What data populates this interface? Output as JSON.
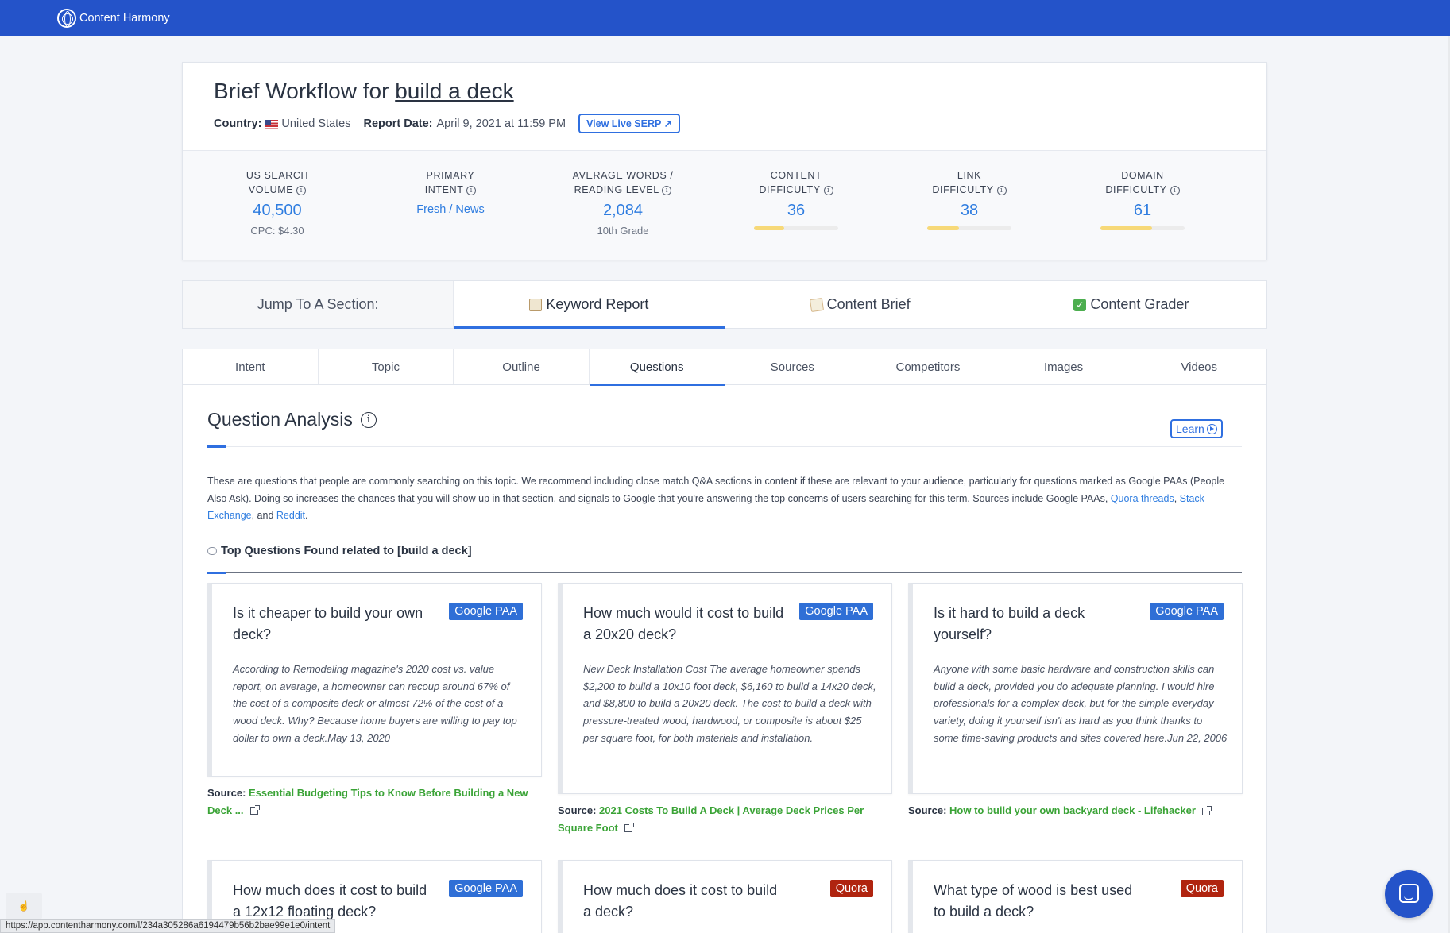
{
  "app": {
    "brand": "Content Harmony"
  },
  "header": {
    "title_prefix": "Brief Workflow for ",
    "keyword": "build a deck",
    "country_label": "Country:",
    "country": "United States",
    "report_date_label": "Report Date:",
    "report_date": "April 9, 2021 at 11:59 PM",
    "serp_button": "View Live SERP"
  },
  "metrics": [
    {
      "label1": "US SEARCH",
      "label2": "VOLUME",
      "value": "40,500",
      "sub": "CPC: $4.30"
    },
    {
      "label1": "PRIMARY",
      "label2": "INTENT",
      "value": "Fresh / News"
    },
    {
      "label1": "AVERAGE WORDS /",
      "label2": "READING LEVEL",
      "value": "2,084",
      "sub": "10th Grade"
    },
    {
      "label1": "CONTENT",
      "label2": "DIFFICULTY",
      "value": "36",
      "level": 0.36
    },
    {
      "label1": "LINK",
      "label2": "DIFFICULTY",
      "value": "38",
      "level": 0.38
    },
    {
      "label1": "DOMAIN",
      "label2": "DIFFICULTY",
      "value": "61",
      "level": 0.61
    }
  ],
  "jump": {
    "label": "Jump To A Section:",
    "items": [
      "Keyword Report",
      "Content Brief",
      "Content Grader"
    ],
    "active": "Keyword Report"
  },
  "tabs": {
    "items": [
      "Intent",
      "Topic",
      "Outline",
      "Questions",
      "Sources",
      "Competitors",
      "Images",
      "Videos"
    ],
    "active": "Questions"
  },
  "question_analysis": {
    "title": "Question Analysis",
    "learn_button": "Learn",
    "description_pre": "These are questions that people are commonly searching on this topic. We recommend including close match Q&A sections in content if these are relevant to your audience, particularly for questions marked as Google PAAs (People Also Ask). Doing so increases the chances that you will show up in that section, and signals to Google that you're answering the top concerns of users searching for this term. Sources include Google PAAs, ",
    "link_quora": "Quora threads",
    "sep1": ", ",
    "link_stack": "Stack Exchange",
    "sep2": ", and ",
    "link_reddit": "Reddit",
    "end": ".",
    "top_questions_label": "Top Questions Found related to [build a deck]"
  },
  "source_label": "Source:",
  "questions": [
    {
      "question": "Is it cheaper to build your own deck?",
      "badge": "Google PAA",
      "answer": "According to Remodeling magazine's 2020 cost vs. value report, on average, a homeowner can recoup around 67% of the cost of a composite deck or almost 72% of the cost of a wood deck. Why? Because home buyers are willing to pay top dollar to own a deck.May 13, 2020",
      "source": "Essential Budgeting Tips to Know Before Building a New Deck ..."
    },
    {
      "question": "How much would it cost to build a 20x20 deck?",
      "badge": "Google PAA",
      "answer": "New Deck Installation Cost The average homeowner spends $2,200 to build a 10x10 foot deck, $6,160 to build a 14x20 deck, and $8,800 to build a 20x20 deck. The cost to build a deck with pressure-treated wood, hardwood, or composite is about $25 per square foot, for both materials and installation.",
      "source": "2021 Costs To Build A Deck | Average Deck Prices Per Square Foot"
    },
    {
      "question": "Is it hard to build a deck yourself?",
      "badge": "Google PAA",
      "answer": "Anyone with some basic hardware and construction skills can build a deck, provided you do adequate planning. I would hire professionals for a complex deck, but for the simple everyday variety, doing it yourself isn't as hard as you think thanks to some time-saving products and sites covered here.Jun 22, 2006",
      "source": "How to build your own backyard deck - Lifehacker"
    },
    {
      "question": "How much does it cost to build a 12x12 floating deck?",
      "badge": "Google PAA"
    },
    {
      "question": "How much does it cost to build a deck?",
      "badge": "Quora"
    },
    {
      "question": "What type of wood is best used to build a deck?",
      "badge": "Quora"
    }
  ],
  "status_url": "https://app.contentharmony.com/l/234a305286a6194479b56b2bae99e1e0/intent",
  "colors": {
    "topbar": "#2453c9",
    "accent": "#2f6fe0",
    "paa": "#2f6fd6",
    "quora": "#b0240f",
    "source_link": "#3aa336"
  }
}
